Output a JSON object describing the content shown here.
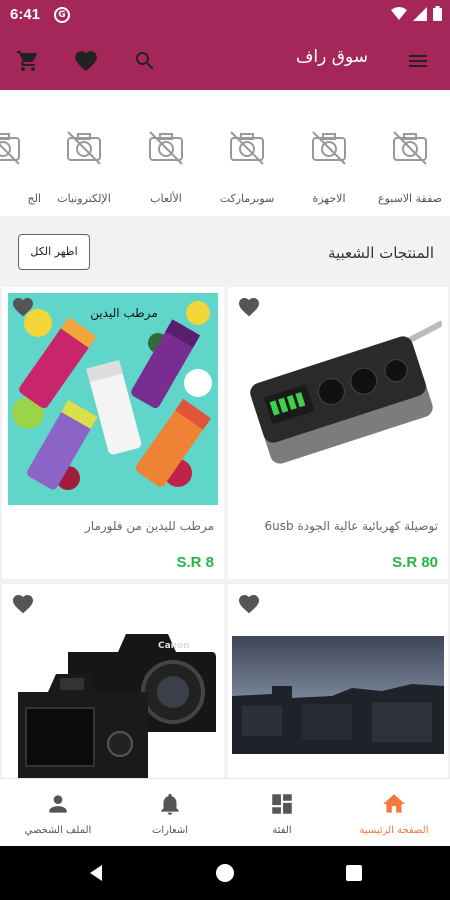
{
  "status_bar": {
    "time": "6:41",
    "app_badge": "G"
  },
  "app_bar": {
    "title": "سوق راف",
    "icons": [
      "cart-icon",
      "heart-icon",
      "search-icon",
      "menu-icon"
    ]
  },
  "categories": [
    {
      "label": "صفقة الاسبوع",
      "icon": "no-photo-icon"
    },
    {
      "label": "الاجهزة",
      "icon": "no-photo-icon"
    },
    {
      "label": "سوبرماركت",
      "icon": "no-photo-icon"
    },
    {
      "label": "الألعاب",
      "icon": "no-photo-icon"
    },
    {
      "label": "الإلكترونيات",
      "icon": "no-photo-icon"
    },
    {
      "label": "الج",
      "icon": "no-photo-icon"
    }
  ],
  "popular": {
    "title": "المنتجات الشعبية",
    "show_all": "اظهر الكل"
  },
  "products": [
    {
      "name": "توصيلة كهربائية عالية الجودة 6usb",
      "price": "S.R 80",
      "image": "power-strip"
    },
    {
      "name": "مرطب لليدين من فلورمار",
      "price": "S.R 8",
      "image": "hand-cream",
      "image_text": "مرطب اليدين"
    },
    {
      "name": "",
      "price": "",
      "image": "night-city"
    },
    {
      "name": "",
      "price": "",
      "image": "cameras",
      "image_text": "Canon"
    }
  ],
  "bottom_nav": [
    {
      "label": "الصفحة الرئيسية",
      "icon": "home-icon",
      "active": true
    },
    {
      "label": "الفئة",
      "icon": "grid-icon",
      "active": false
    },
    {
      "label": "اشعارات",
      "icon": "bell-icon",
      "active": false
    },
    {
      "label": "الملف الشخصي",
      "icon": "person-icon",
      "active": false
    }
  ],
  "colors": {
    "primary": "#a5275a",
    "price": "#27b24a",
    "active": "#f5793a"
  }
}
